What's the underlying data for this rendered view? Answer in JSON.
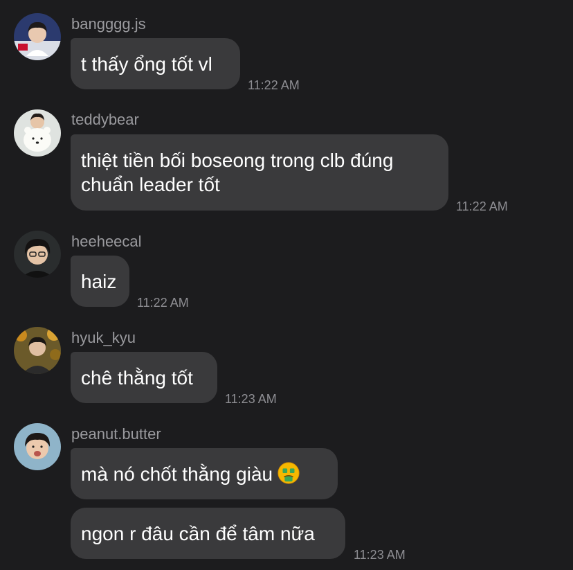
{
  "messages": [
    {
      "username": "bangggg.js",
      "avatar": "avatar-bangggg",
      "bubbles": [
        {
          "lines": [
            "t thấy ổng tốt vl"
          ]
        }
      ],
      "time": "11:22 AM"
    },
    {
      "username": "teddybear",
      "avatar": "avatar-teddybear",
      "bubbles": [
        {
          "lines": [
            "thiệt tiền bối boseong trong clb đúng",
            "chuẩn leader tốt"
          ]
        }
      ],
      "time": "11:22 AM"
    },
    {
      "username": "heeheecal",
      "avatar": "avatar-heeheecal",
      "bubbles": [
        {
          "lines": [
            "haiz"
          ]
        }
      ],
      "time": "11:22 AM"
    },
    {
      "username": "hyuk_kyu",
      "avatar": "avatar-hyuk-kyu",
      "bubbles": [
        {
          "lines": [
            "chê thằng tốt"
          ]
        }
      ],
      "time": "11:23 AM"
    },
    {
      "username": "peanut.butter",
      "avatar": "avatar-peanut-butter",
      "bubbles": [
        {
          "lines": [
            "mà nó chốt thằng giàu"
          ],
          "emoji": "money-mouth-face-icon"
        },
        {
          "lines": [
            "ngon r đâu cần để tâm nữa"
          ]
        }
      ],
      "time": "11:23 AM"
    }
  ],
  "colors": {
    "background": "#1c1c1e",
    "bubble": "#3a3a3c",
    "username": "#9a9a9e",
    "timestamp": "#8e8e93",
    "text": "#ffffff"
  }
}
